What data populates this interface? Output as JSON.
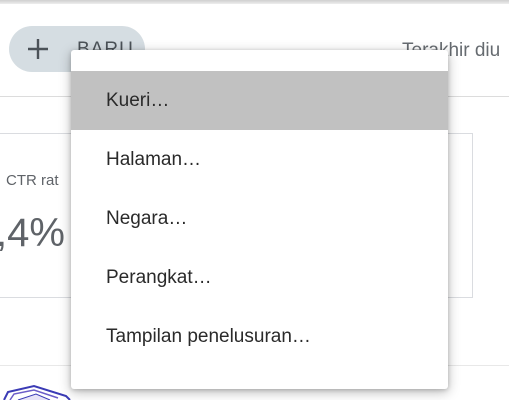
{
  "toolbar": {
    "new_button_label": "BARU",
    "date_filter_label": "Terakhir diu"
  },
  "metric": {
    "label": "CTR rat",
    "value": ",4%",
    "info_glyph": ")"
  },
  "menu": {
    "items": [
      {
        "label": "Kueri…",
        "highlighted": true
      },
      {
        "label": "Halaman…",
        "highlighted": false
      },
      {
        "label": "Negara…",
        "highlighted": false
      },
      {
        "label": "Perangkat…",
        "highlighted": false
      },
      {
        "label": "Tampilan penelusuran…",
        "highlighted": false
      }
    ]
  },
  "icons": {
    "new_button_icon": "plus-icon"
  },
  "colors": {
    "chip_background": "#d5dde2",
    "highlight": "#c1c1c1"
  }
}
